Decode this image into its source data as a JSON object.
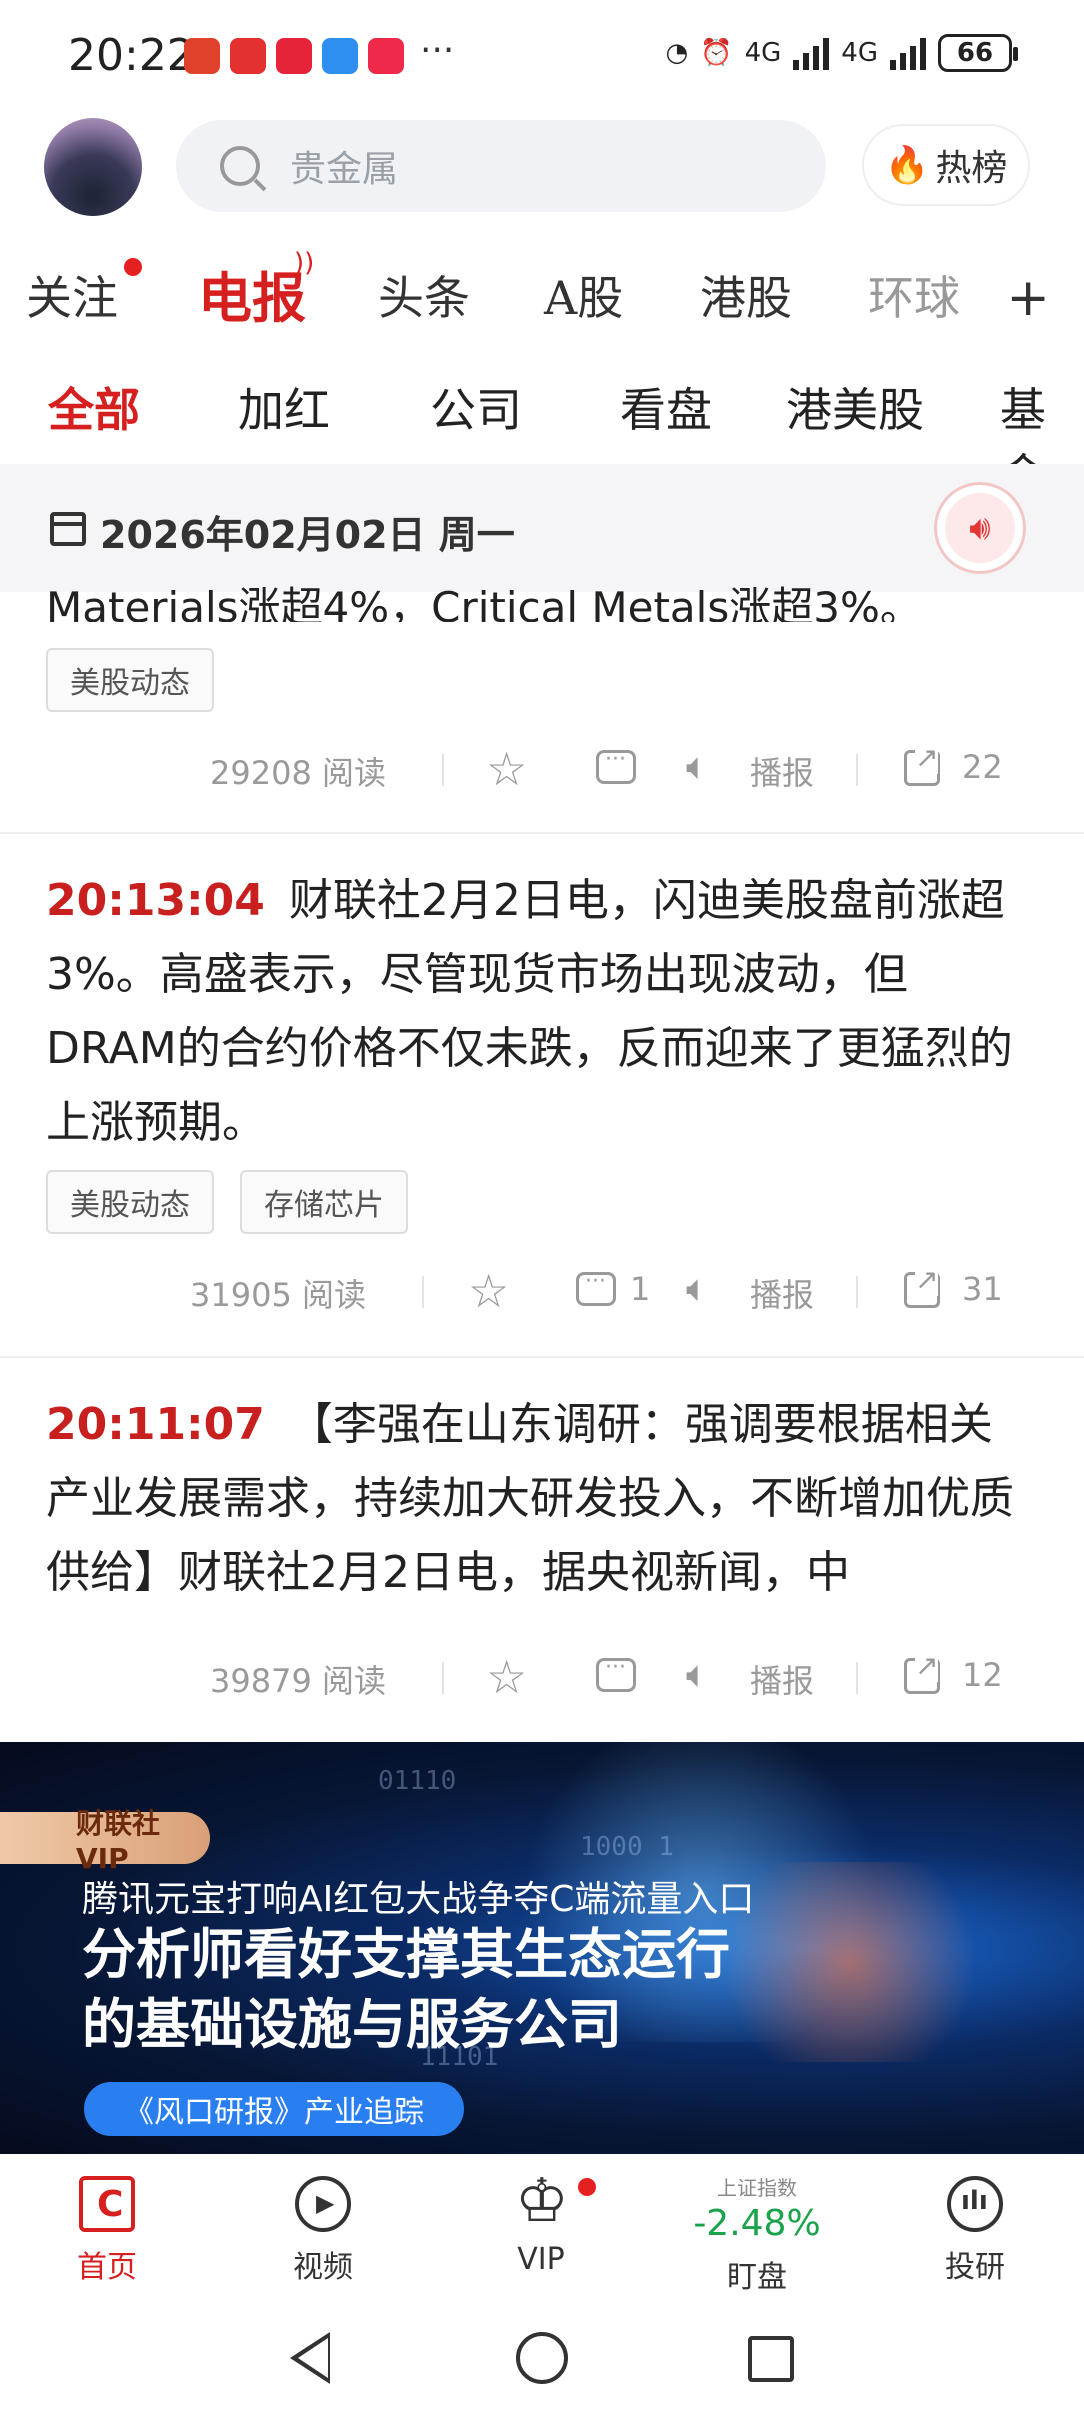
{
  "status_bar": {
    "time": "20:22",
    "battery": "66",
    "network1": "4G",
    "network2": "4G",
    "more": "···"
  },
  "search": {
    "placeholder": "贵金属"
  },
  "hot_button": {
    "label": "热榜"
  },
  "main_tabs": [
    "关注",
    "电报",
    "头条",
    "A股",
    "港股",
    "环球"
  ],
  "sub_tabs": [
    "全部",
    "加红",
    "公司",
    "看盘",
    "港美股",
    "基金"
  ],
  "date_bar": {
    "date": "2026年02月02日 周一"
  },
  "feed": {
    "partial_text": "Materials涨超4%，Critical Metals涨超3%。",
    "item0": {
      "tags": [
        "美股动态"
      ],
      "reads": "29208 阅读",
      "play": "播报",
      "shares": "22"
    },
    "item1": {
      "time": "20:13:04",
      "text": "财联社2月2日电，闪迪美股盘前涨超3%。高盛表示，尽管现货市场出现波动，但DRAM的合约价格不仅未跌，反而迎来了更猛烈的上涨预期。",
      "tags": [
        "美股动态",
        "存储芯片"
      ],
      "reads": "31905 阅读",
      "comments": "1",
      "play": "播报",
      "shares": "31"
    },
    "item2": {
      "time": "20:11:07",
      "text": "【李强在山东调研：强调要根据相关产业发展需求，持续加大研发投入，不断增加优质供给】财联社2月2日电，据央视新闻，中",
      "reads": "39879 阅读",
      "play": "播报",
      "shares": "12"
    }
  },
  "banner": {
    "badge": "财联社VIP",
    "line1": "腾讯元宝打响AI红包大战争夺C端流量入口",
    "line2": "分析师看好支撑其生态运行的基础设施与服务公司",
    "pill": "《风口研报》产业追踪",
    "code1": "01110",
    "code2": "1000 1",
    "code3": "11101"
  },
  "bottom_nav": {
    "home": "首页",
    "video": "视频",
    "vip": "VIP",
    "market_index": "上证指数",
    "market_pct": "-2.48%",
    "watch": "盯盘",
    "research": "投研"
  },
  "colors": {
    "accent": "#d61f1f",
    "up_down_green": "#1aa34a",
    "time_red": "#c81f1f"
  }
}
